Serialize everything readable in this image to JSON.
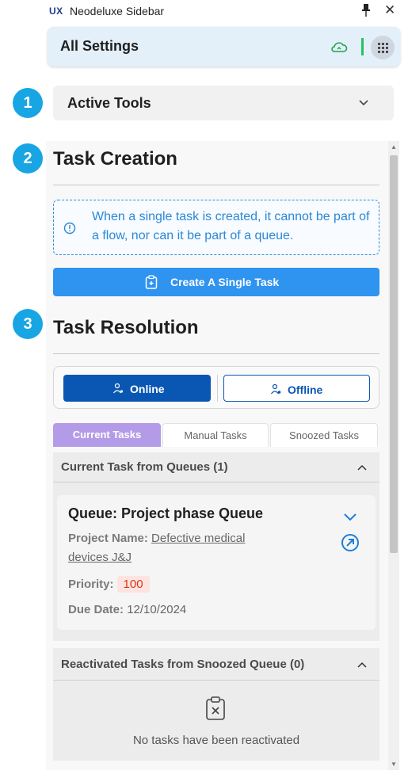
{
  "titlebar": {
    "logo": "UX",
    "title": "Neodeluxe Sidebar"
  },
  "header": {
    "title": "All Settings",
    "icons": [
      "cloud-sync-icon",
      "apps-grid-icon",
      "user-icon"
    ],
    "accent": "#22c55e"
  },
  "steps": [
    "1",
    "2",
    "3"
  ],
  "active_tools": {
    "label": "Active Tools"
  },
  "task_creation": {
    "title": "Task Creation",
    "info": "When a single task is created, it cannot be part of a flow, nor can it be part of a queue.",
    "create_button": "Create A Single Task"
  },
  "task_resolution": {
    "title": "Task Resolution",
    "online_label": "Online",
    "offline_label": "Offline",
    "tabs": [
      {
        "label": "Current Tasks",
        "active": true
      },
      {
        "label": "Manual Tasks",
        "active": false
      },
      {
        "label": "Snoozed Tasks",
        "active": false
      }
    ]
  },
  "current_queue": {
    "title": "Current Task from Queues (1)",
    "card": {
      "title": "Queue: Project phase Queue",
      "project_label": "Project Name: ",
      "project_value_1": "Defective medical",
      "project_value_2": "devices J&J",
      "priority_label": "Priority:",
      "priority_value": "100",
      "due_label": "Due Date:",
      "due_value": "12/10/2024"
    }
  },
  "reactivated": {
    "title": "Reactivated Tasks from Snoozed Queue (0)",
    "empty_text": "No tasks have been reactivated"
  },
  "colors": {
    "step_badge": "#17a6e3",
    "primary": "#2f93f0",
    "online": "#0a57b3",
    "tab_active": "#b49be8",
    "priority": "#d4391f"
  }
}
